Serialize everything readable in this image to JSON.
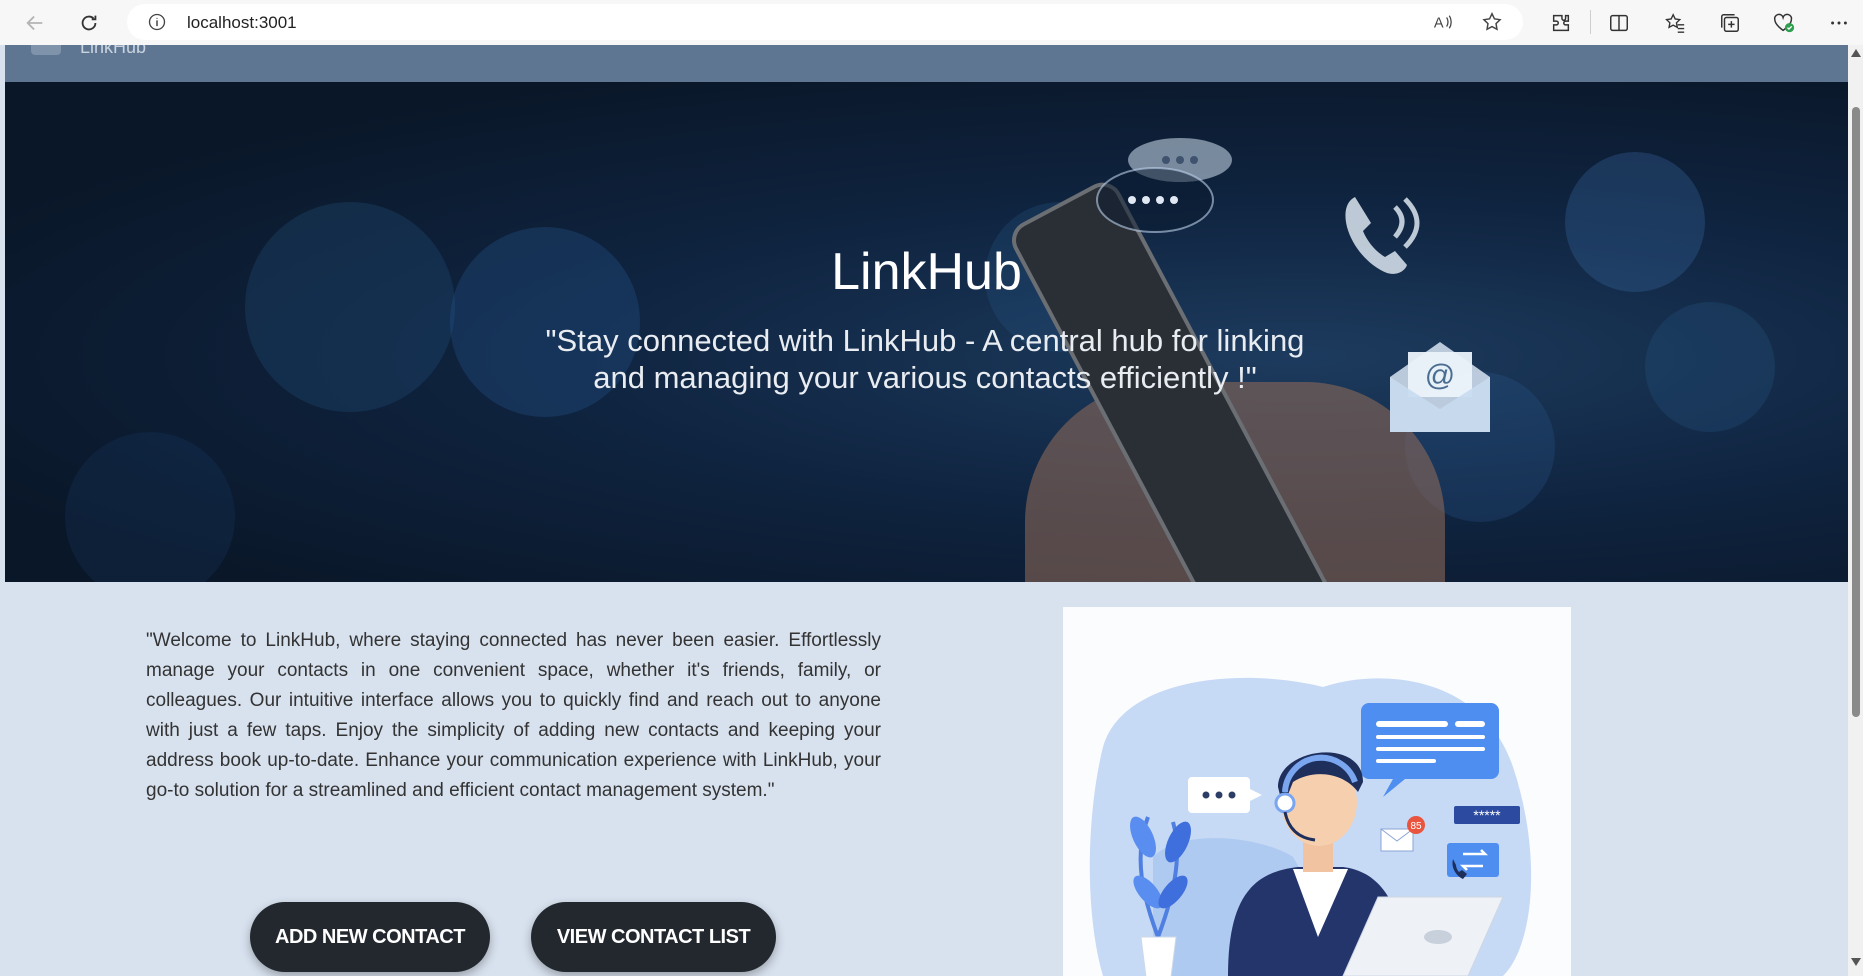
{
  "browser": {
    "url": "localhost:3001",
    "icons": [
      "back-icon",
      "reload-icon",
      "info-icon",
      "read-aloud-icon",
      "favorite-star-icon",
      "extensions-icon",
      "split-screen-icon",
      "favorites-icon",
      "collections-icon",
      "browser-essentials-icon",
      "more-icon"
    ]
  },
  "nav": {
    "brand": "LinkHub"
  },
  "hero": {
    "title": "LinkHub",
    "tagline": "\"Stay connected with LinkHub - A central hub for linking and managing your various contacts efficiently !\""
  },
  "intro": {
    "text": "\"Welcome to LinkHub, where staying connected has never been easier. Effortlessly manage your contacts in one convenient space, whether it's friends, family, or colleagues. Our intuitive interface allows you to quickly find and reach out to anyone with just a few taps. Enjoy the simplicity of adding new contacts and keeping your address book up-to-date. Enhance your communication experience with LinkHub, your go-to solution for a streamlined and efficient contact management system.\""
  },
  "buttons": {
    "add_contact": "ADD NEW CONTACT",
    "view_list": "VIEW CONTACT LIST"
  },
  "illustration": {
    "badge_count": "85",
    "password_mask": "*****"
  },
  "colors": {
    "nav_bg": "#5e7692",
    "page_bg": "#d8e2ef",
    "button_bg": "#23282f",
    "accent_blue": "#5b8ee6"
  }
}
